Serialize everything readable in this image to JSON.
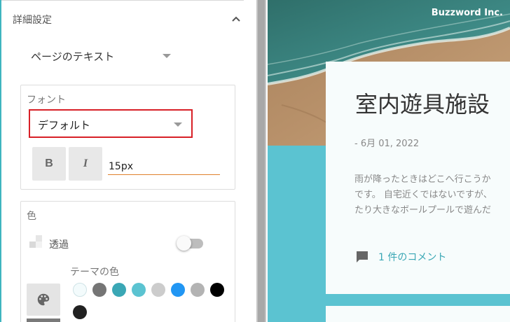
{
  "panel": {
    "section_title": "詳細設定",
    "page_text_select": "ページのテキスト",
    "font_section": {
      "label": "フォント",
      "font_select_value": "デフォルト",
      "bold_label": "B",
      "italic_label": "I",
      "size_value": "15px"
    },
    "color_section": {
      "label": "色",
      "transparency_label": "透過",
      "transparency_on": false,
      "theme_colors_label": "テーマの色",
      "swatches": [
        "#f3fbfc",
        "#757575",
        "#3aa7b5",
        "#5bc3d1",
        "#cccccc",
        "#2196f3",
        "#b3b3b3",
        "#000000",
        "#212121"
      ]
    },
    "accent_color": "#d82027"
  },
  "preview": {
    "brand": "Buzzword Inc.",
    "post_title": "室内遊具施設",
    "post_date": "- 6月 01, 2022",
    "post_body_lines": [
      "雨が降ったときはどこへ行こうか",
      "です。 自宅近くではないですが、",
      "たり大きなボールプールで遊んだ"
    ],
    "comment_link": "1 件のコメント"
  }
}
